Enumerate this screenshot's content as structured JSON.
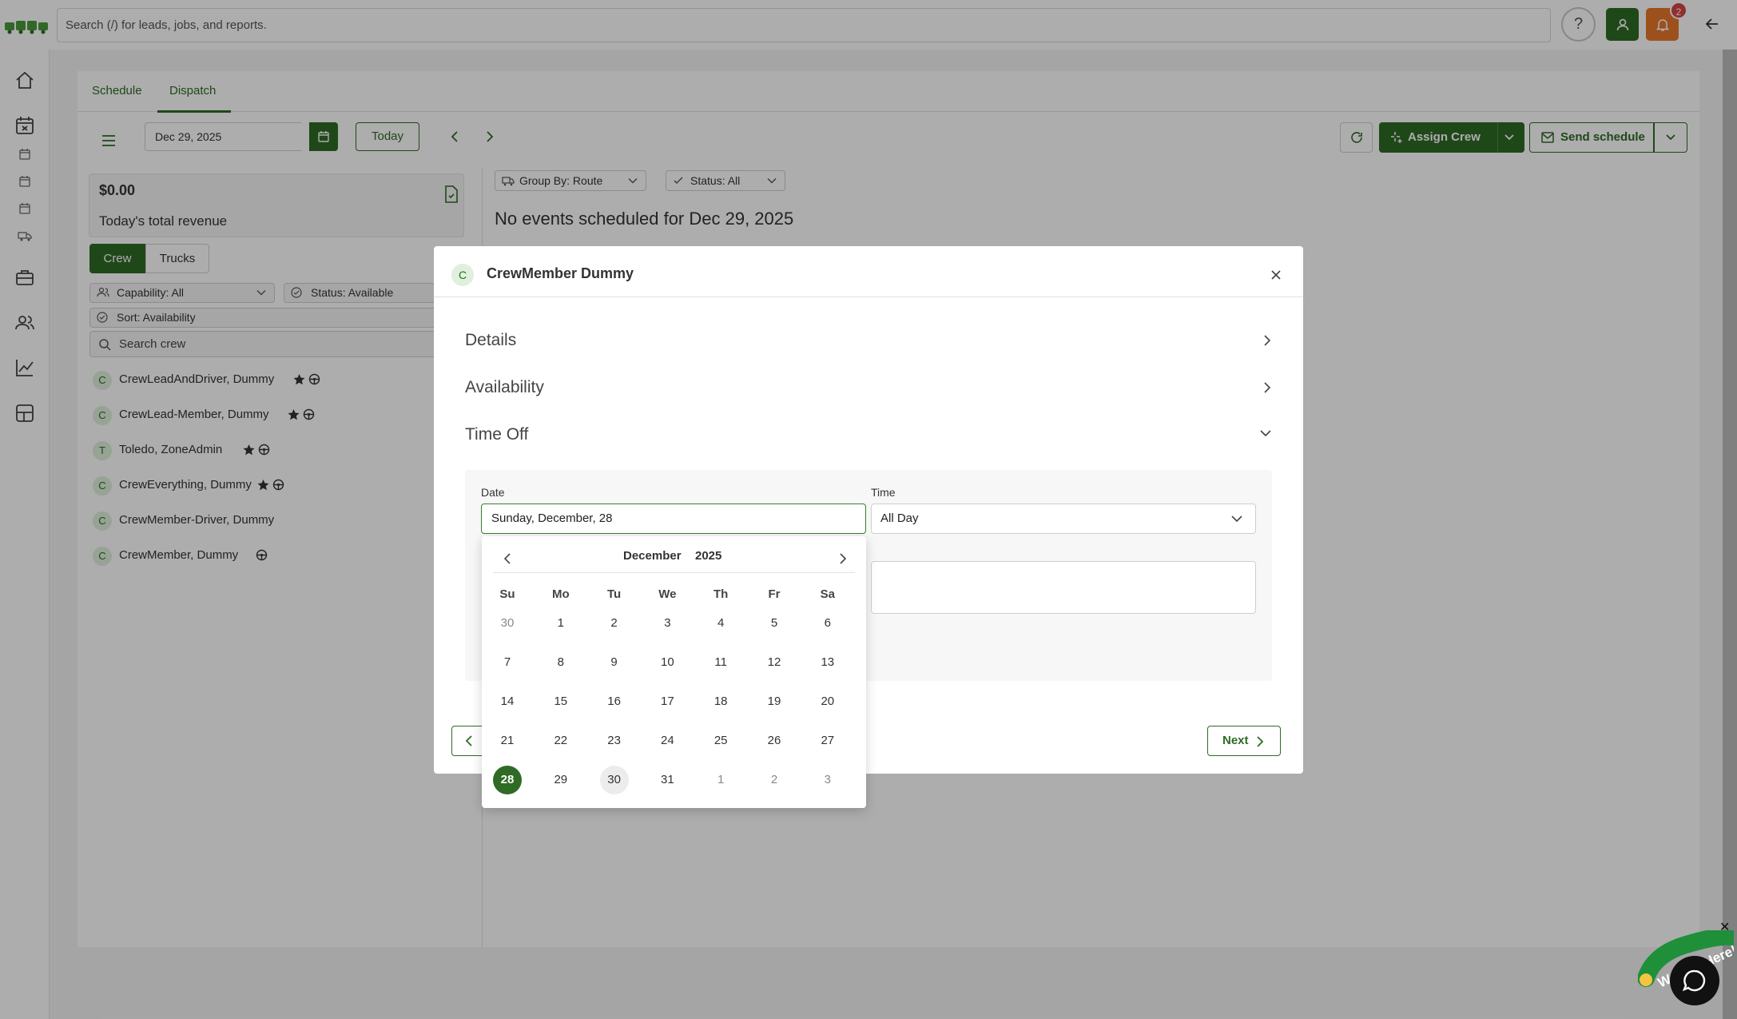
{
  "topbar": {
    "search_placeholder": "Search (/) for leads, jobs, and reports.",
    "help_label": "?",
    "notification_count": "2"
  },
  "tabs": {
    "schedule": "Schedule",
    "dispatch": "Dispatch"
  },
  "toolbar": {
    "date": "Dec 29, 2025",
    "today_label": "Today",
    "assign_crew_label": "Assign Crew",
    "send_schedule_label": "Send schedule"
  },
  "revenue": {
    "value": "$0.00",
    "label": "Today's total revenue"
  },
  "crew_tabs": {
    "crew": "Crew",
    "trucks": "Trucks"
  },
  "filters": {
    "capability": "Capability: All",
    "status": "Status: Available",
    "sort": "Sort: Availability",
    "search_placeholder": "Search crew"
  },
  "crew": [
    {
      "initial": "C",
      "name": "CrewLeadAndDriver, Dummy"
    },
    {
      "initial": "C",
      "name": "CrewLead-Member, Dummy"
    },
    {
      "initial": "T",
      "name": "Toledo, ZoneAdmin"
    },
    {
      "initial": "C",
      "name": "CrewEverything, Dummy"
    },
    {
      "initial": "C",
      "name": "CrewMember-Driver, Dummy"
    },
    {
      "initial": "C",
      "name": "CrewMember, Dummy"
    }
  ],
  "board": {
    "group_by": "Group By: Route",
    "status": "Status: All",
    "no_events": "No events scheduled for Dec 29, 2025"
  },
  "modal": {
    "avatar_initial": "C",
    "title": "CrewMember Dummy",
    "sections": {
      "details": "Details",
      "availability": "Availability",
      "time_off": "Time Off"
    },
    "date_label": "Date",
    "date_value": "Sunday, December, 28",
    "time_label": "Time",
    "time_value": "All Day",
    "next_label": "Next"
  },
  "calendar": {
    "month": "December",
    "year": "2025",
    "weekdays": [
      "Su",
      "Mo",
      "Tu",
      "We",
      "Th",
      "Fr",
      "Sa"
    ],
    "weeks": [
      [
        "30",
        "1",
        "2",
        "3",
        "4",
        "5",
        "6"
      ],
      [
        "7",
        "8",
        "9",
        "10",
        "11",
        "12",
        "13"
      ],
      [
        "14",
        "15",
        "16",
        "17",
        "18",
        "19",
        "20"
      ],
      [
        "21",
        "22",
        "23",
        "24",
        "25",
        "26",
        "27"
      ],
      [
        "28",
        "29",
        "30",
        "31",
        "1",
        "2",
        "3"
      ]
    ],
    "selected": "28",
    "today": "30"
  },
  "chat": {
    "badge_text": "We Are Here!"
  },
  "colors": {
    "brand": "#2f6b25",
    "notify": "#e8772a",
    "badge": "#d64545"
  }
}
